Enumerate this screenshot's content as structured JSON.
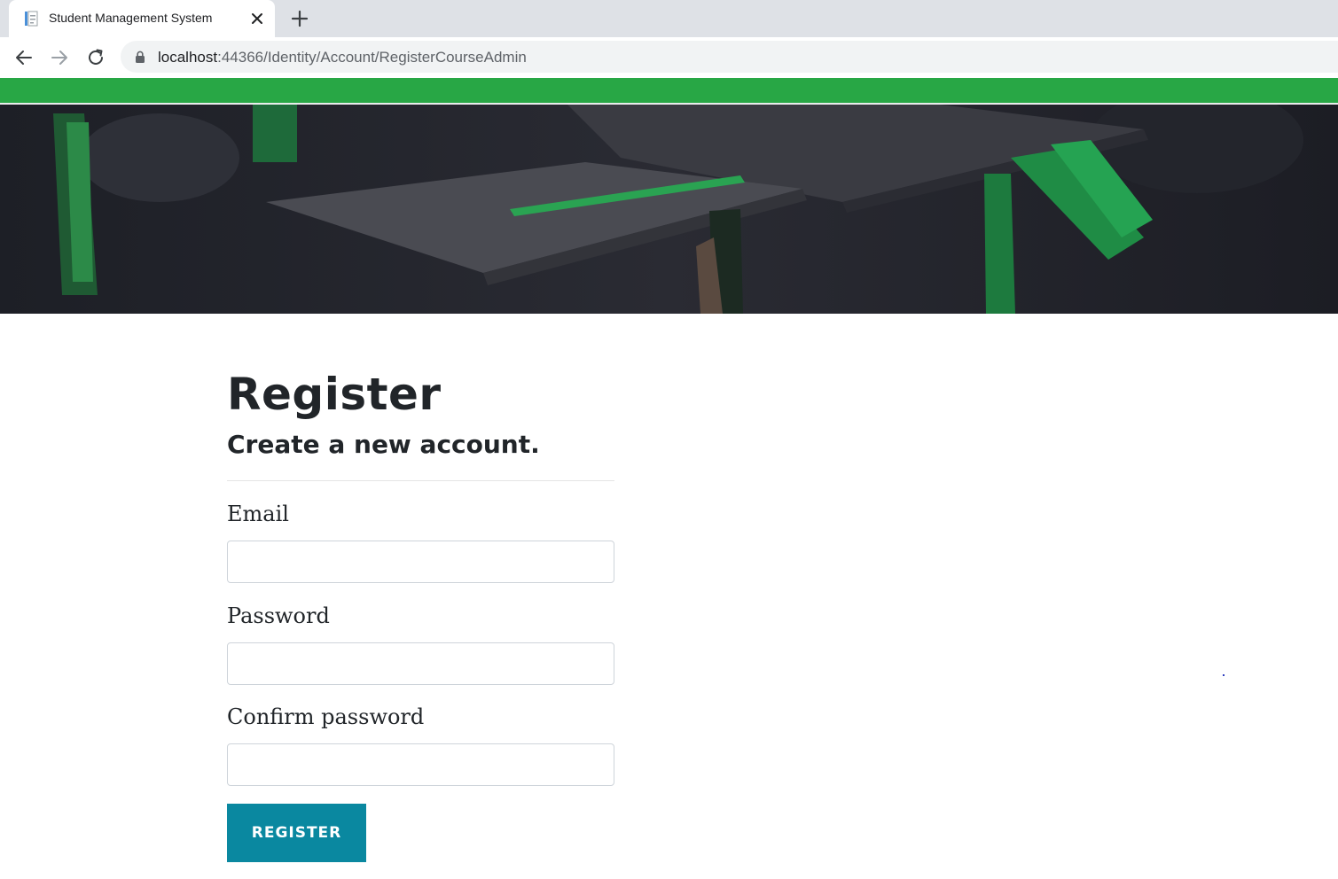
{
  "browser": {
    "tab_title": "Student Management System",
    "url_host": "localhost",
    "url_path": ":44366/Identity/Account/RegisterCourseAdmin",
    "icons": [
      "page-favicon",
      "close-icon",
      "plus-icon",
      "back-arrow-icon",
      "forward-arrow-icon",
      "reload-icon",
      "lock-icon"
    ]
  },
  "header": {
    "bar_color": "#28a745"
  },
  "form": {
    "title": "Register",
    "subtitle": "Create a new account.",
    "email_label": "Email",
    "email_value": "",
    "password_label": "Password",
    "password_value": "",
    "confirm_label": "Confirm password",
    "confirm_value": "",
    "submit_label": "REGISTER",
    "submit_color": "#0a88a0"
  }
}
